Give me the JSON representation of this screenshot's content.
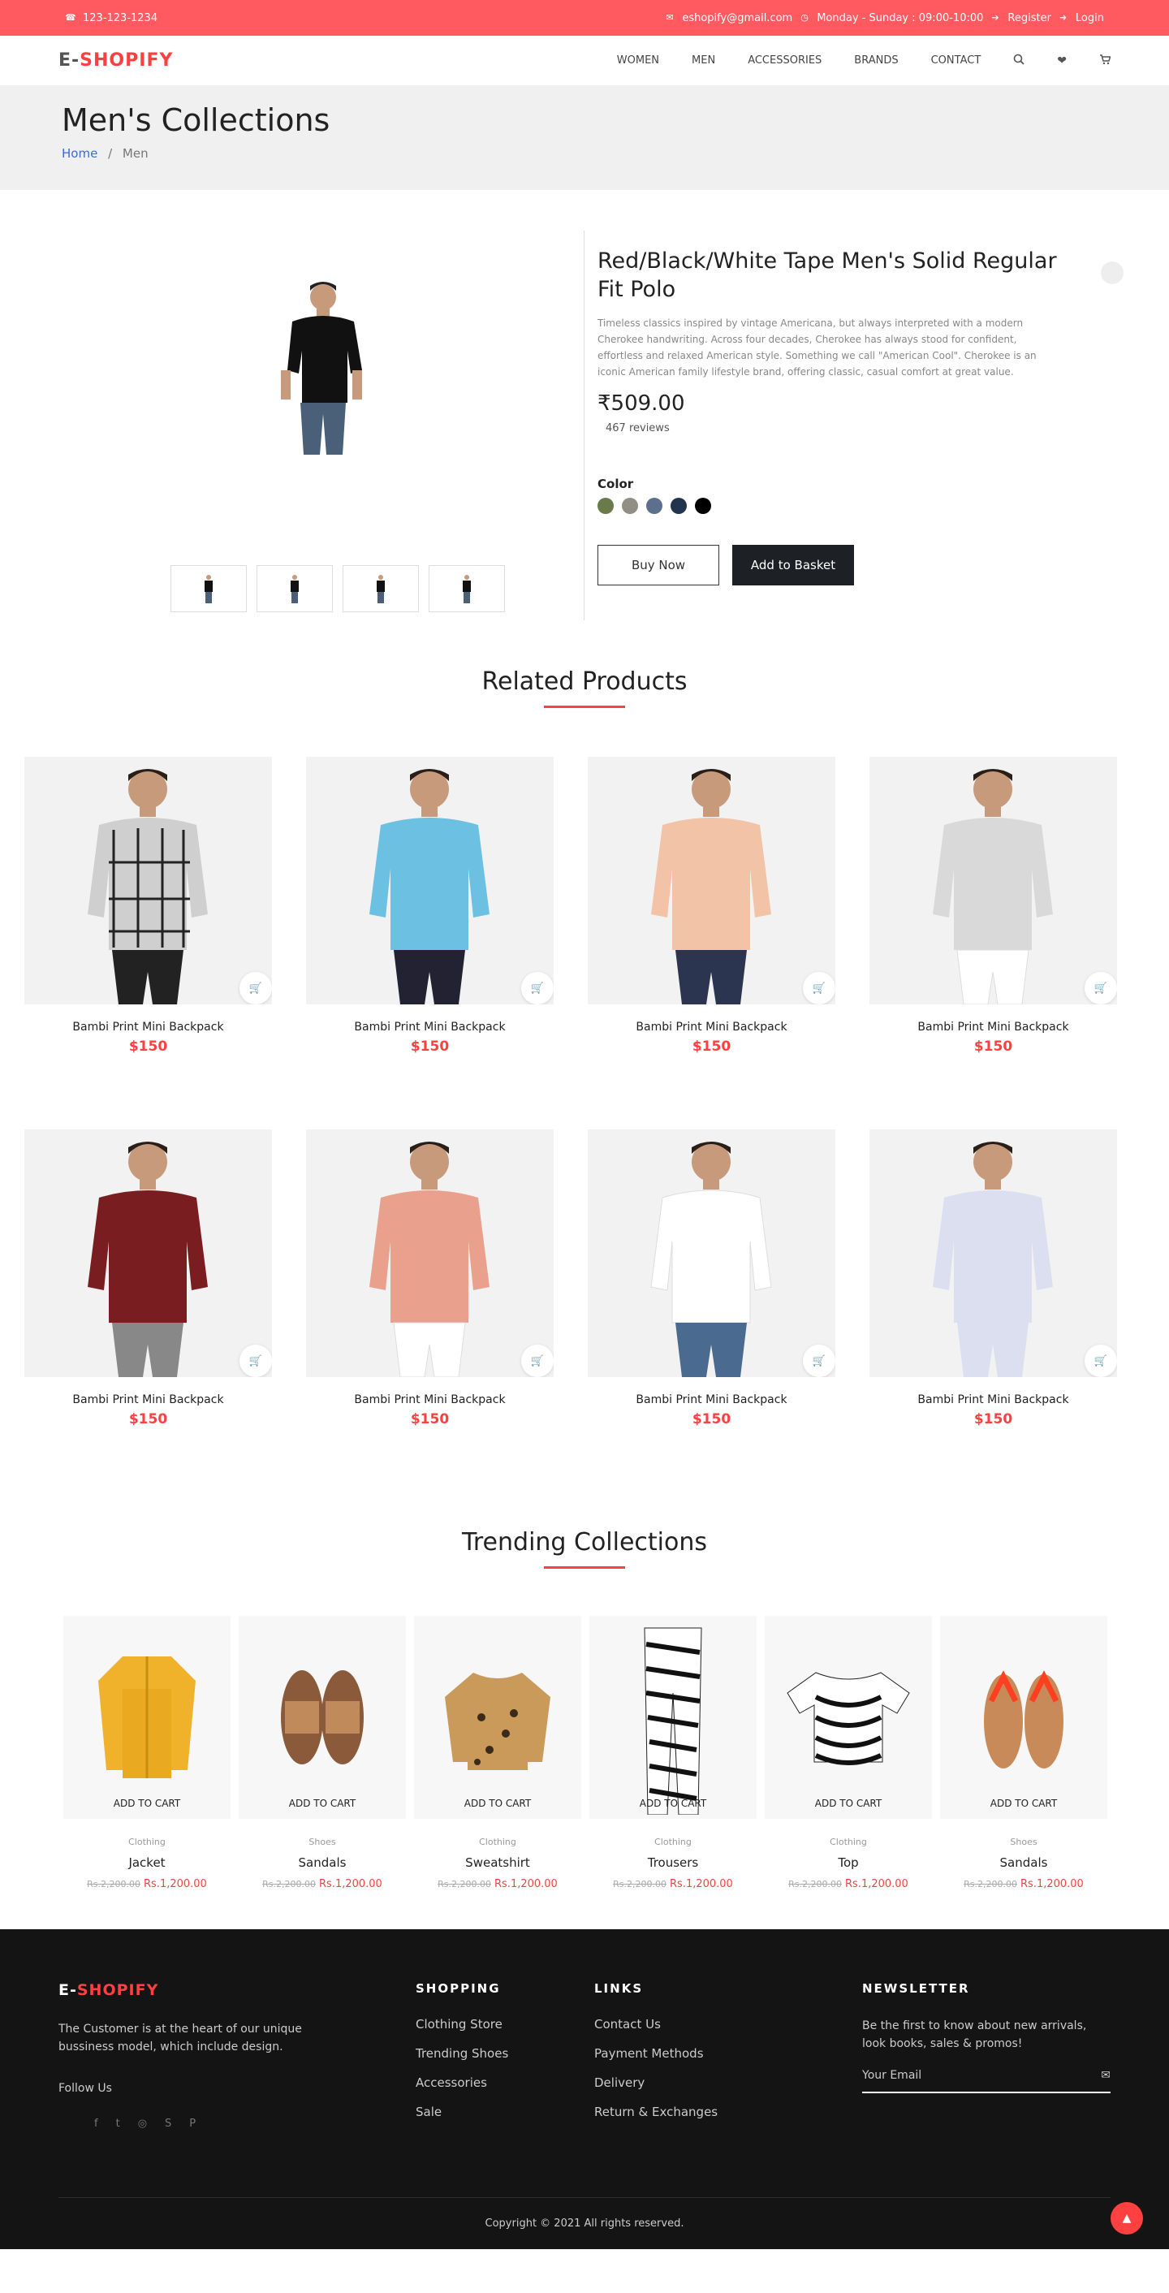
{
  "topbar": {
    "phone": "123-123-1234",
    "email": "eshopify@gmail.com",
    "hours": "Monday - Sunday : 09:00-10:00",
    "register": "Register",
    "login": "Login"
  },
  "brand": {
    "prefix": "E-",
    "name": "SHOPIFY"
  },
  "nav": {
    "items": [
      "WOMEN",
      "MEN",
      "ACCESSORIES",
      "BRANDS",
      "CONTACT"
    ]
  },
  "hero": {
    "title": "Men's Collections",
    "crumb_home": "Home",
    "crumb_sep": "/",
    "crumb_current": "Men"
  },
  "product": {
    "title": "Red/Black/White Tape Men's Solid Regular Fit Polo",
    "description": "Timeless classics inspired by vintage Americana, but always interpreted with a modern Cherokee handwriting. Across four decades, Cherokee has always stood for confident, effortless and relaxed American style. Something we call \"American Cool\". Cherokee is an iconic American family lifestyle brand, offering classic, casual comfort at great value.",
    "price": "₹509.00",
    "reviews": "467 reviews",
    "color_label": "Color",
    "colors": [
      "#6b7a4a",
      "#8f8f86",
      "#5d6f8f",
      "#23354e",
      "#000000"
    ],
    "buy_now": "Buy Now",
    "add_to_basket": "Add to Basket"
  },
  "related": {
    "title": "Related Products",
    "items": [
      {
        "name": "Bambi Print Mini Backpack",
        "price": "$150"
      },
      {
        "name": "Bambi Print Mini Backpack",
        "price": "$150"
      },
      {
        "name": "Bambi Print Mini Backpack",
        "price": "$150"
      },
      {
        "name": "Bambi Print Mini Backpack",
        "price": "$150"
      },
      {
        "name": "Bambi Print Mini Backpack",
        "price": "$150"
      },
      {
        "name": "Bambi Print Mini Backpack",
        "price": "$150"
      },
      {
        "name": "Bambi Print Mini Backpack",
        "price": "$150"
      },
      {
        "name": "Bambi Print Mini Backpack",
        "price": "$150"
      }
    ]
  },
  "trending": {
    "title": "Trending Collections",
    "add_to_cart": "ADD TO CART",
    "items": [
      {
        "category": "Clothing",
        "name": "Jacket",
        "old_price": "Rs.2,200.00",
        "price": "Rs.1,200.00"
      },
      {
        "category": "Shoes",
        "name": "Sandals",
        "old_price": "Rs.2,200.00",
        "price": "Rs.1,200.00"
      },
      {
        "category": "Clothing",
        "name": "Sweatshirt",
        "old_price": "Rs.2,200.00",
        "price": "Rs.1,200.00"
      },
      {
        "category": "Clothing",
        "name": "Trousers",
        "old_price": "Rs.2,200.00",
        "price": "Rs.1,200.00"
      },
      {
        "category": "Clothing",
        "name": "Top",
        "old_price": "Rs.2,200.00",
        "price": "Rs.1,200.00"
      },
      {
        "category": "Shoes",
        "name": "Sandals",
        "old_price": "Rs.2,200.00",
        "price": "Rs.1,200.00"
      }
    ]
  },
  "footer": {
    "about": "The Customer is at the heart of our unique bussiness model, which include design.",
    "follow": "Follow Us",
    "shopping_title": "SHOPPING",
    "shopping": [
      "Clothing Store",
      "Trending Shoes",
      "Accessories",
      "Sale"
    ],
    "links_title": "LINKS",
    "links": [
      "Contact Us",
      "Payment Methods",
      "Delivery",
      "Return & Exchanges"
    ],
    "newsletter_title": "NEWSLETTER",
    "newsletter_text": "Be the first to know about new arrivals, look books, sales & promos!",
    "email_placeholder": "Your Email",
    "copyright": "Copyright © 2021 All rights reserved."
  },
  "colors": {
    "accent": "#ff5a5f",
    "price_red": "#ff4040",
    "footer_bg": "#141414",
    "button_dark": "#1d2024"
  }
}
